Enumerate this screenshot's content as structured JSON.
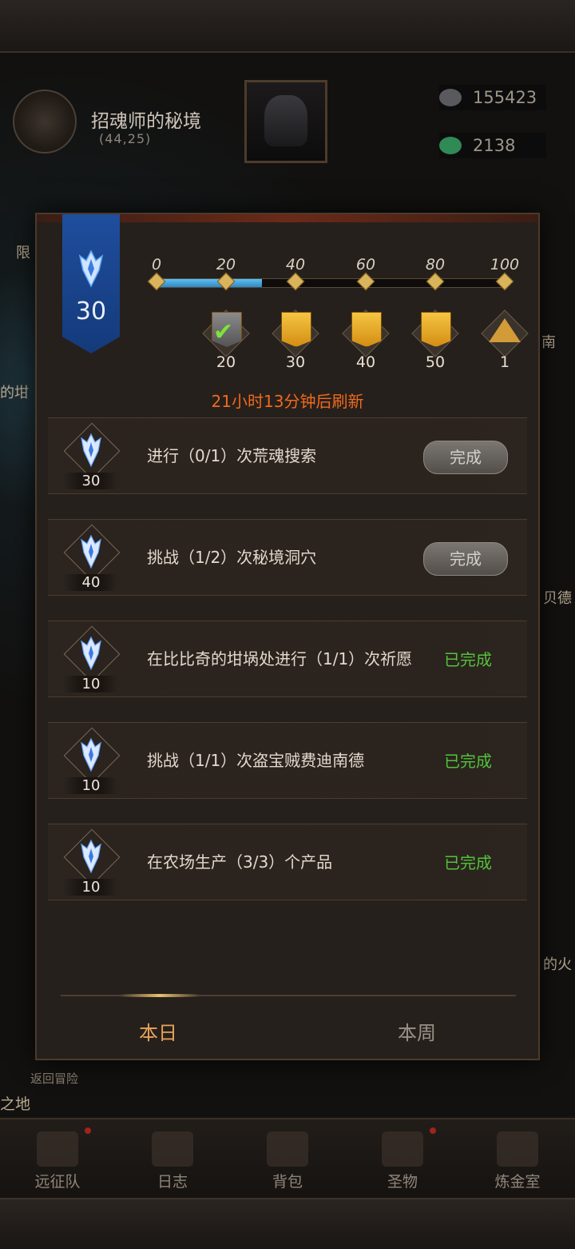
{
  "background": {
    "location": {
      "title": "招魂师的秘境",
      "coords": "(44,25)"
    },
    "resources": [
      {
        "icon": "stone-icon",
        "value": "155423"
      },
      {
        "icon": "gem-icon",
        "value": "2138"
      }
    ],
    "side_texts": {
      "left_1": "限",
      "left_2": "的坩",
      "right_1": "南",
      "right_2": "贝德",
      "right_3": "的火",
      "return": "返回冒险",
      "bottom_left": "之地"
    },
    "nav": [
      {
        "label": "远征队",
        "icon": "viking-helmet-icon"
      },
      {
        "label": "日志",
        "icon": "journal-icon"
      },
      {
        "label": "背包",
        "icon": "backpack-icon"
      },
      {
        "label": "圣物",
        "icon": "relic-icon"
      },
      {
        "label": "炼金室",
        "icon": "alchemy-icon"
      }
    ]
  },
  "modal": {
    "level": "30",
    "milestones": [
      "0",
      "20",
      "40",
      "60",
      "80",
      "100"
    ],
    "progress_value": 30,
    "progress_max": 100,
    "rewards": [
      {
        "count": "20",
        "icon": "gray-flag-icon",
        "claimed": true
      },
      {
        "count": "30",
        "icon": "gold-flag-icon",
        "claimed": false
      },
      {
        "count": "40",
        "icon": "gold-flag-icon",
        "claimed": false
      },
      {
        "count": "50",
        "icon": "gold-flag-icon",
        "claimed": false
      },
      {
        "count": "1",
        "icon": "pyramid-icon",
        "claimed": false
      }
    ],
    "refresh_text": "21小时13分钟后刷新",
    "tasks": [
      {
        "points": "30",
        "desc": "进行（0/1）次荒魂搜索",
        "status": "button",
        "status_text": "完成"
      },
      {
        "points": "40",
        "desc": "挑战（1/2）次秘境洞穴",
        "status": "button",
        "status_text": "完成"
      },
      {
        "points": "10",
        "desc": "在比比奇的坩埚处进行（1/1）次祈愿",
        "status": "done",
        "status_text": "已完成"
      },
      {
        "points": "10",
        "desc": "挑战（1/1）次盗宝贼费迪南德",
        "status": "done",
        "status_text": "已完成"
      },
      {
        "points": "10",
        "desc": "在农场生产（3/3）个产品",
        "status": "done",
        "status_text": "已完成"
      }
    ],
    "tabs": {
      "today": "本日",
      "week": "本周"
    }
  },
  "colors": {
    "accent_orange": "#f06a1c",
    "done_green": "#52c23b",
    "banner_blue": "#1f4e9d"
  }
}
